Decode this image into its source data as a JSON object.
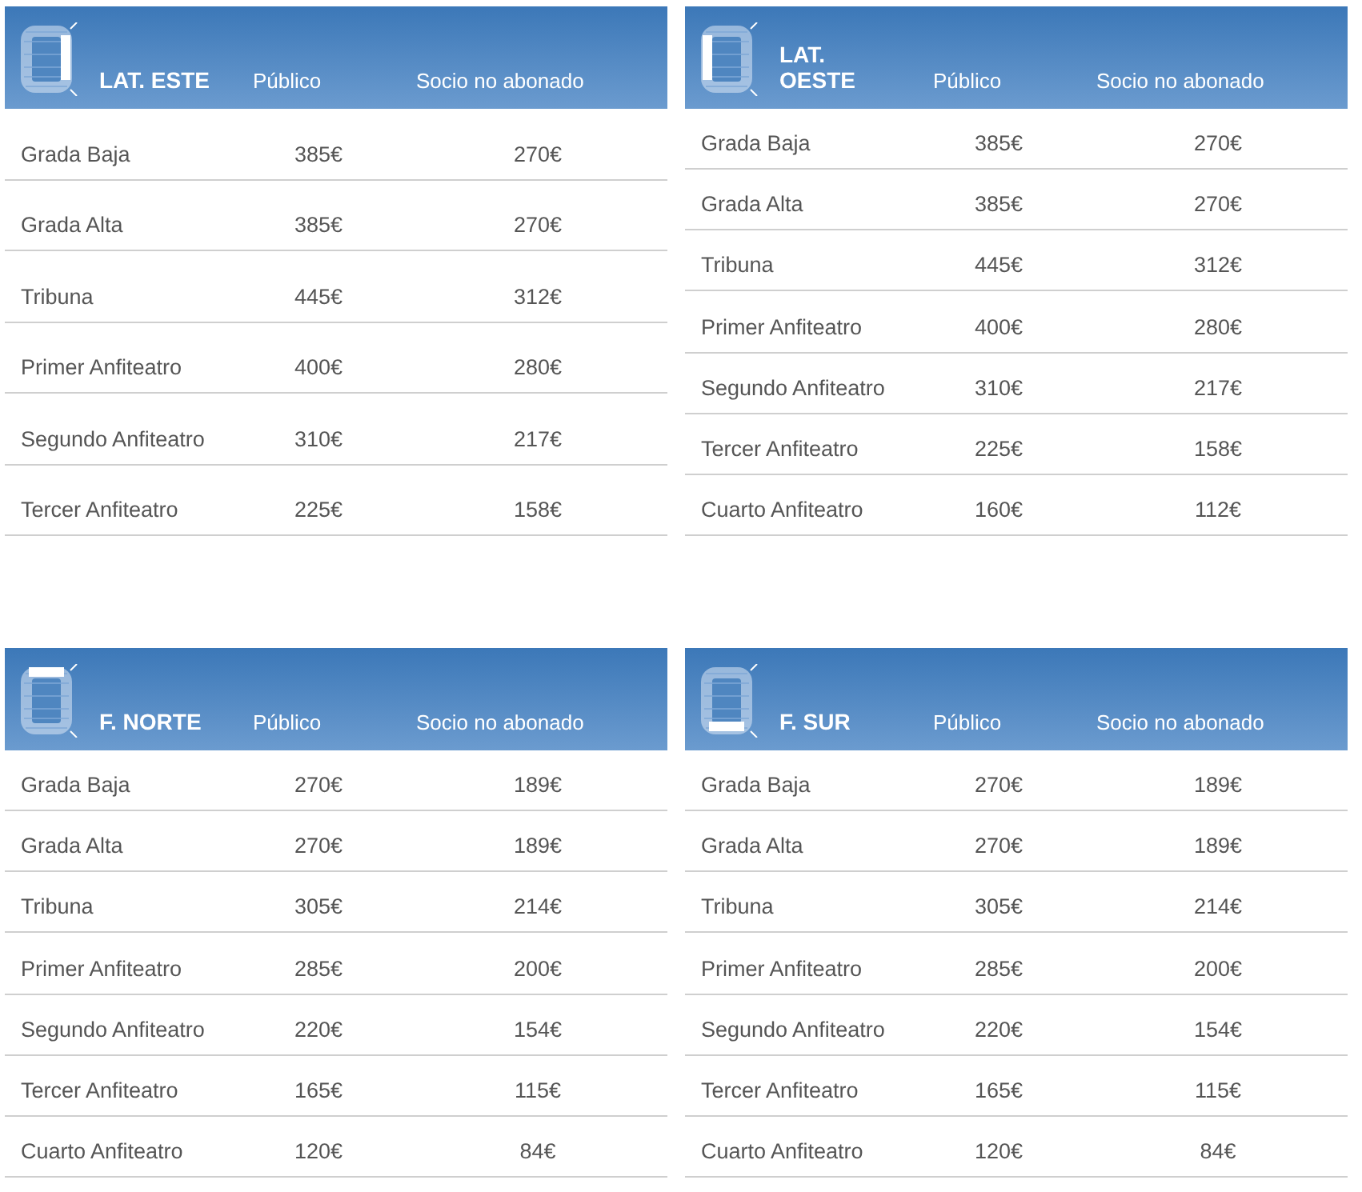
{
  "table_rows": [
    {
      "tables": [
        {
          "title": [
            "LAT. ESTE"
          ],
          "kind": "east",
          "columns": [
            "Público",
            "Socio no abonado"
          ],
          "rows": [
            {
              "name": "Grada Baja",
              "publico": "385€",
              "socio": "270€"
            },
            {
              "name": "Grada Alta",
              "publico": "385€",
              "socio": "270€"
            },
            {
              "name": "Tribuna",
              "publico": "445€",
              "socio": "312€"
            },
            {
              "name": "Primer Anfiteatro",
              "publico": "400€",
              "socio": "280€"
            },
            {
              "name": "Segundo Anfiteatro",
              "publico": "310€",
              "socio": "217€"
            },
            {
              "name": "Tercer Anfiteatro",
              "publico": "225€",
              "socio": "158€"
            }
          ]
        },
        {
          "title": [
            "LAT.",
            "OESTE"
          ],
          "kind": "west",
          "columns": [
            "Público",
            "Socio no abonado"
          ],
          "rows": [
            {
              "name": "Grada Baja",
              "publico": "385€",
              "socio": "270€"
            },
            {
              "name": "Grada Alta",
              "publico": "385€",
              "socio": "270€"
            },
            {
              "name": "Tribuna",
              "publico": "445€",
              "socio": "312€"
            },
            {
              "name": "Primer Anfiteatro",
              "publico": "400€",
              "socio": "280€"
            },
            {
              "name": "Segundo Anfiteatro",
              "publico": "310€",
              "socio": "217€"
            },
            {
              "name": "Tercer Anfiteatro",
              "publico": "225€",
              "socio": "158€"
            },
            {
              "name": "Cuarto Anfiteatro",
              "publico": "160€",
              "socio": "112€"
            }
          ]
        }
      ]
    },
    {
      "tables": [
        {
          "title": [
            "F. NORTE"
          ],
          "kind": "north",
          "columns": [
            "Público",
            "Socio no abonado"
          ],
          "rows": [
            {
              "name": "Grada Baja",
              "publico": "270€",
              "socio": "189€"
            },
            {
              "name": "Grada Alta",
              "publico": "270€",
              "socio": "189€"
            },
            {
              "name": "Tribuna",
              "publico": "305€",
              "socio": "214€"
            },
            {
              "name": "Primer Anfiteatro",
              "publico": "285€",
              "socio": "200€"
            },
            {
              "name": "Segundo Anfiteatro",
              "publico": "220€",
              "socio": "154€"
            },
            {
              "name": "Tercer Anfiteatro",
              "publico": "165€",
              "socio": "115€"
            },
            {
              "name": "Cuarto Anfiteatro",
              "publico": "120€",
              "socio": "84€"
            }
          ]
        },
        {
          "title": [
            "F. SUR"
          ],
          "kind": "south",
          "columns": [
            "Público",
            "Socio no abonado"
          ],
          "rows": [
            {
              "name": "Grada Baja",
              "publico": "270€",
              "socio": "189€"
            },
            {
              "name": "Grada Alta",
              "publico": "270€",
              "socio": "189€"
            },
            {
              "name": "Tribuna",
              "publico": "305€",
              "socio": "214€"
            },
            {
              "name": "Primer Anfiteatro",
              "publico": "285€",
              "socio": "200€"
            },
            {
              "name": "Segundo Anfiteatro",
              "publico": "220€",
              "socio": "154€"
            },
            {
              "name": "Tercer Anfiteatro",
              "publico": "165€",
              "socio": "115€"
            },
            {
              "name": "Cuarto Anfiteatro",
              "publico": "120€",
              "socio": "84€"
            }
          ]
        }
      ]
    }
  ]
}
